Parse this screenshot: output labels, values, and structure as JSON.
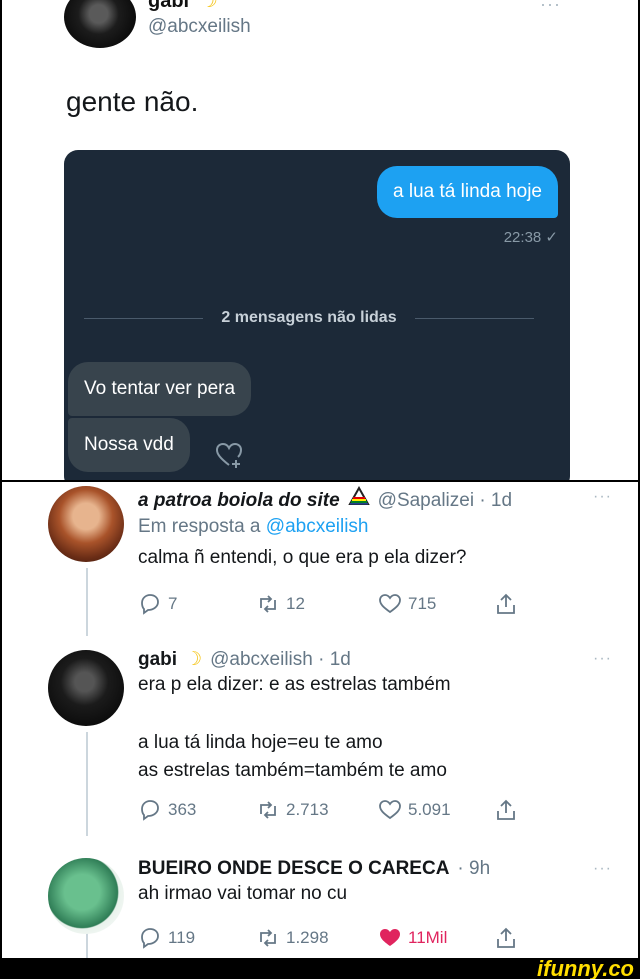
{
  "original_tweet": {
    "name": "gabi",
    "handle": "@abcxeilish",
    "text": "gente não.",
    "menu": "···"
  },
  "dm": {
    "outgoing_message": "a lua tá linda hoje",
    "outgoing_time": "22:38 ✓",
    "unread_divider": "2 mensagens não lidas",
    "incoming_1": "Vo tentar ver pera",
    "incoming_2": "Nossa vdd"
  },
  "replies": [
    {
      "name": "a patroa boiola do site",
      "handle": "@Sapalizei · 1d",
      "reply_to_prefix": "Em resposta a",
      "reply_to_mention": "@abcxeilish",
      "text": "calma ñ entendi, o que era p ela dizer?",
      "replies": "7",
      "retweets": "12",
      "likes": "715",
      "menu": "···"
    },
    {
      "name": "gabi",
      "handle": "@abcxeilish · 1d",
      "line_1": "era p ela dizer: e as estrelas também",
      "line_2": "a lua tá linda hoje=eu te amo",
      "line_3": "as estrelas também=também te amo",
      "replies": "363",
      "retweets": "2.713",
      "likes": "5.091",
      "menu": "···"
    },
    {
      "name": "BUEIRO ONDE DESCE O CARECA",
      "handle": "· 9h",
      "text": "ah irmao vai tomar no cu",
      "replies": "119",
      "retweets": "1.298",
      "likes": "11Mil",
      "menu": "···"
    }
  ],
  "watermark": "ifunny.co",
  "colors": {
    "twitter_blue": "#1da1f2",
    "like_red": "#e0245e",
    "dm_background": "#1c2938",
    "watermark_yellow": "#ffdd00"
  }
}
